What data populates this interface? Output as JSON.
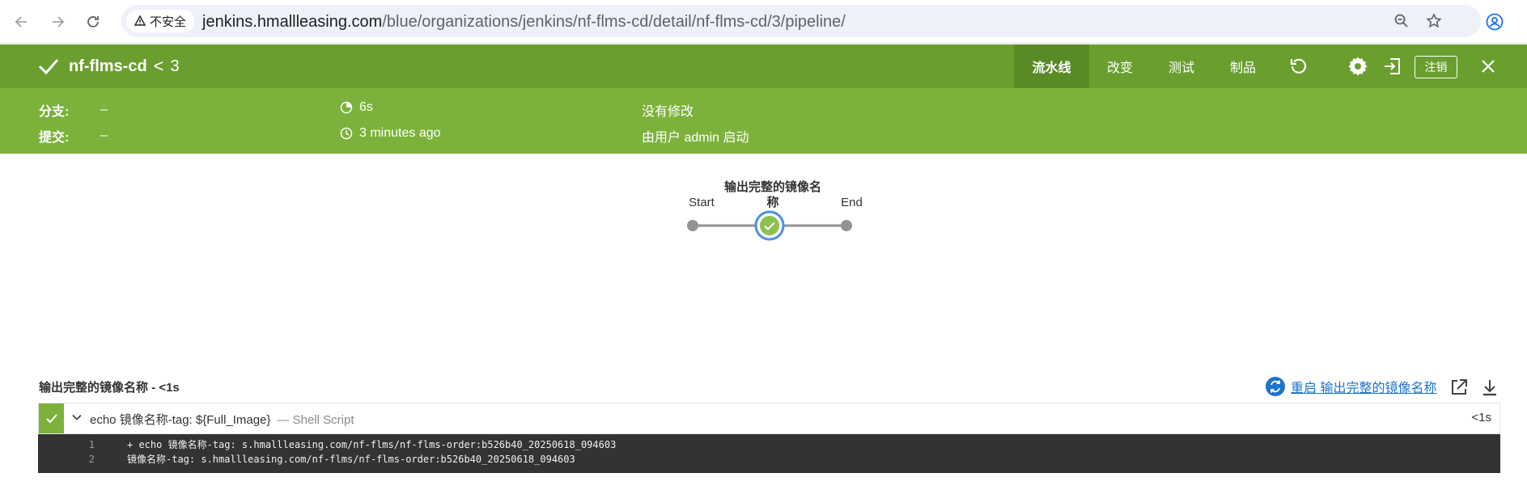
{
  "browser": {
    "security_label": "不安全",
    "url_host": "jenkins.hmallleasing.com",
    "url_path": "/blue/organizations/jenkins/nf-flms-cd/detail/nf-flms-cd/3/pipeline/"
  },
  "header": {
    "job_name": "nf-flms-cd",
    "separator": "<",
    "run_number": "3",
    "tabs": [
      {
        "label": "流水线",
        "active": true
      },
      {
        "label": "改变",
        "active": false
      },
      {
        "label": "测试",
        "active": false
      },
      {
        "label": "制品",
        "active": false
      }
    ],
    "logout_label": "注销"
  },
  "run_info": {
    "branch_label": "分支:",
    "branch_value": "–",
    "commit_label": "提交:",
    "commit_value": "–",
    "duration": "6s",
    "started_ago": "3 minutes ago",
    "changes": "没有修改",
    "started_by": "由用户 admin 启动"
  },
  "pipeline": {
    "start_label": "Start",
    "stage_label_line1": "输出完整的镜像名",
    "stage_label_line2": "称",
    "end_label": "End"
  },
  "log": {
    "title": "输出完整的镜像名称 - <1s",
    "restart_label": "重启 输出完整的镜像名称",
    "step_command": "echo 镜像名称-tag: ${Full_Image}",
    "step_type": "— Shell Script",
    "step_duration": "<1s",
    "lines": [
      {
        "num": "1",
        "text": "+ echo 镜像名称-tag: s.hmallleasing.com/nf-flms/nf-flms-order:b526b40_20250618_094603"
      },
      {
        "num": "2",
        "text": "镜像名称-tag: s.hmallleasing.com/nf-flms/nf-flms-order:b526b40_20250618_094603"
      }
    ]
  },
  "colors": {
    "header_green": "#6a9f30",
    "info_green": "#7cb23b",
    "success_green": "#7cb23b",
    "link_blue": "#1d74c9",
    "console_bg": "#333333"
  }
}
